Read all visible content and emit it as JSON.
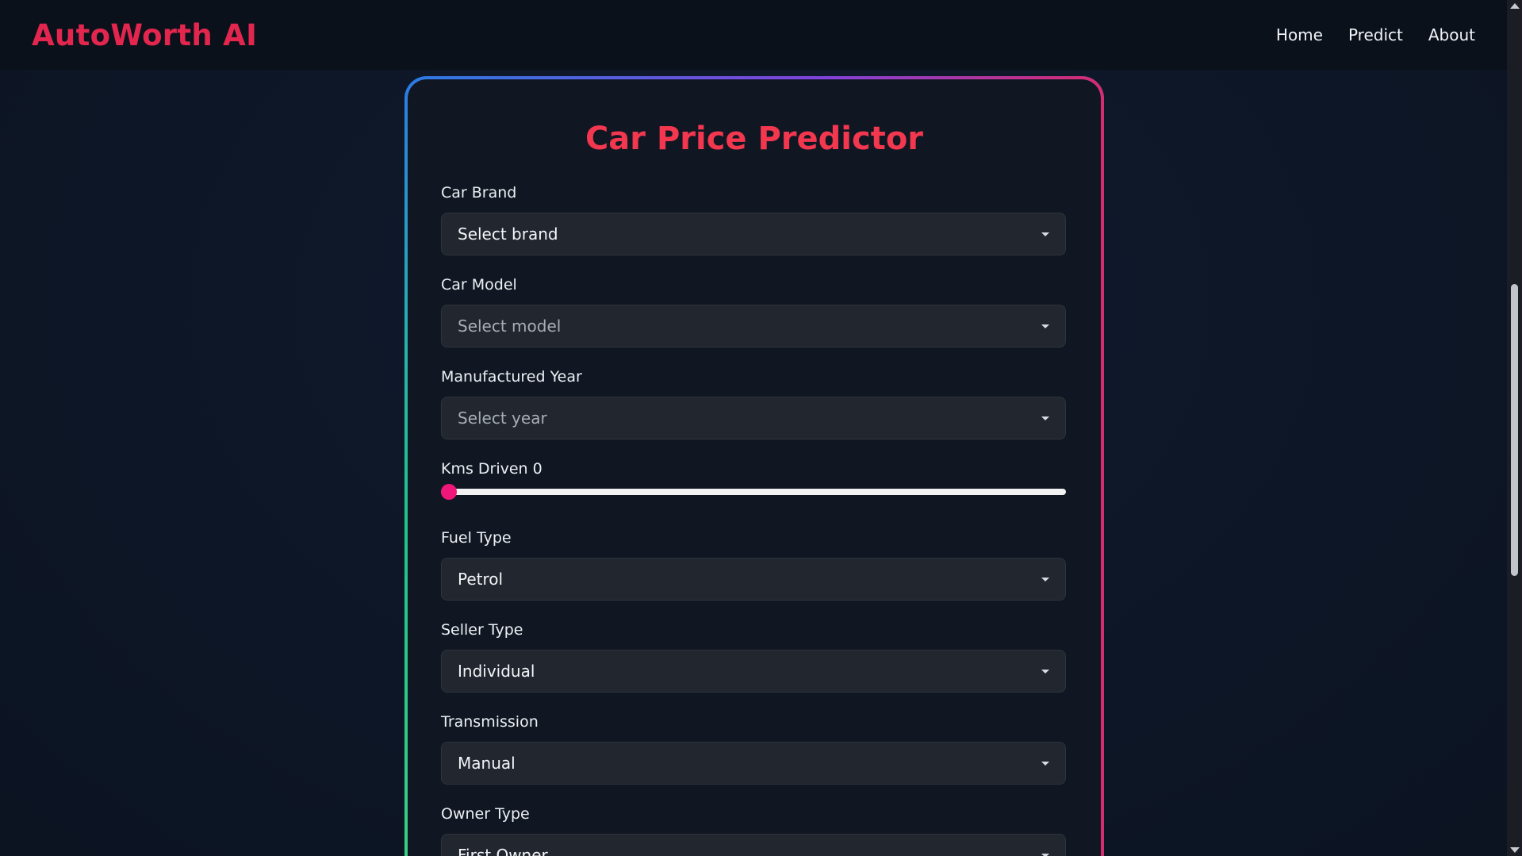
{
  "nav": {
    "brand": "AutoWorth AI",
    "links": [
      "Home",
      "Predict",
      "About"
    ]
  },
  "form": {
    "title": "Car Price Predictor",
    "brand": {
      "label": "Car Brand",
      "value": "Select brand"
    },
    "model": {
      "label": "Car Model",
      "value": "Select model"
    },
    "year": {
      "label": "Manufactured Year",
      "value": "Select year"
    },
    "kms": {
      "label": "Kms Driven 0",
      "value": 0
    },
    "fuel": {
      "label": "Fuel Type",
      "value": "Petrol"
    },
    "seller": {
      "label": "Seller Type",
      "value": "Individual"
    },
    "transmission": {
      "label": "Transmission",
      "value": "Manual"
    },
    "owner": {
      "label": "Owner Type",
      "value": "First Owner"
    }
  },
  "colors": {
    "brand": "#e3264e",
    "title": "#f2374f",
    "slider_thumb": "#f0177a"
  },
  "icons": {
    "caret": "chevron-down-icon"
  }
}
